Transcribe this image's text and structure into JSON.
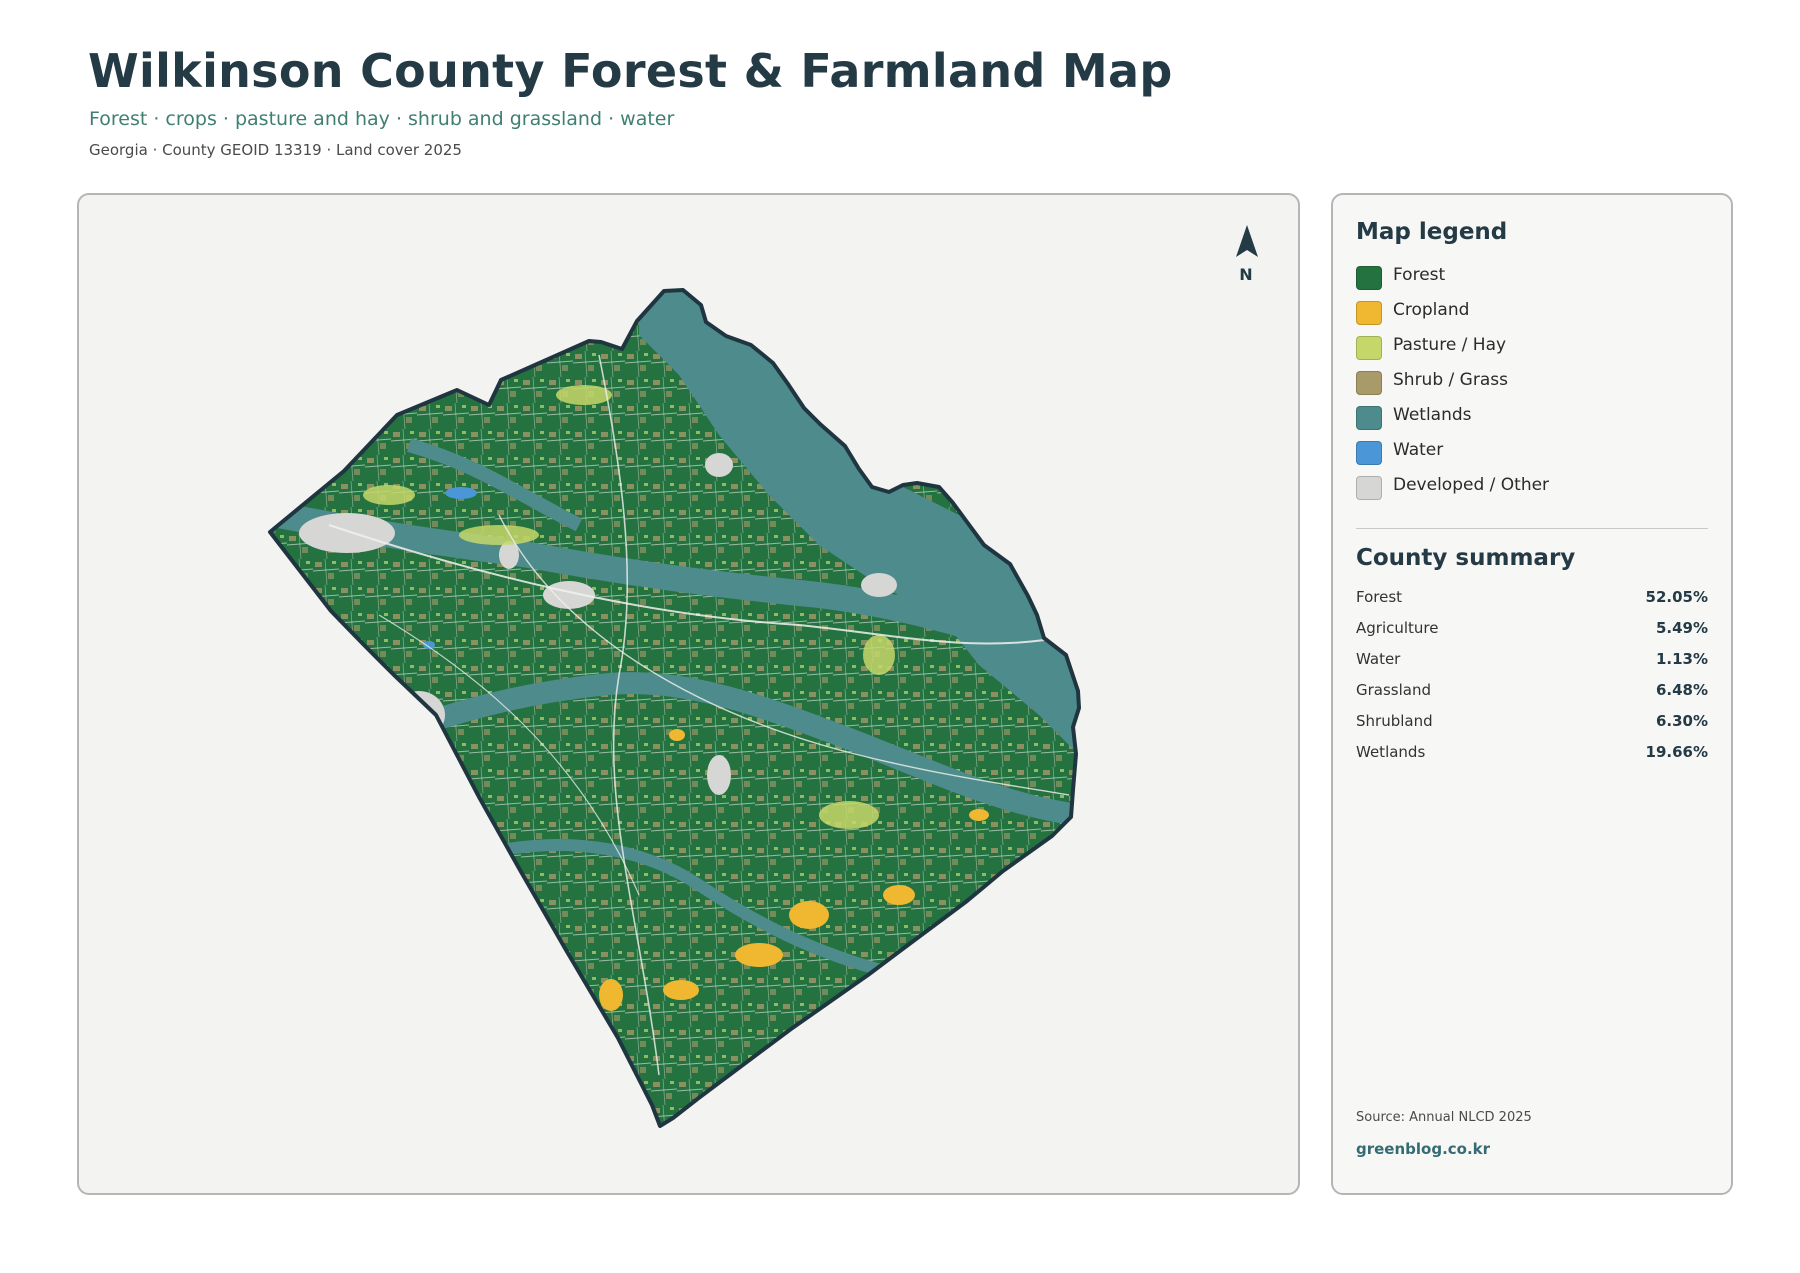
{
  "header": {
    "title": "Wilkinson County Forest & Farmland Map",
    "subtitle": "Forest · crops · pasture and hay · shrub and grassland · water",
    "meta": "Georgia · County GEOID 13319 · Land cover 2025"
  },
  "map": {
    "north_label": "N"
  },
  "legend": {
    "title": "Map legend",
    "items": [
      {
        "label": "Forest",
        "color": "#237240"
      },
      {
        "label": "Cropland",
        "color": "#efb830"
      },
      {
        "label": "Pasture / Hay",
        "color": "#c6d76a"
      },
      {
        "label": "Shrub / Grass",
        "color": "#a99a69"
      },
      {
        "label": "Wetlands",
        "color": "#4d8b8d"
      },
      {
        "label": "Water",
        "color": "#4b96d6"
      },
      {
        "label": "Developed / Other",
        "color": "#d6d6d4"
      }
    ]
  },
  "summary": {
    "title": "County summary",
    "rows": [
      {
        "label": "Forest",
        "value": "52.05%"
      },
      {
        "label": "Agriculture",
        "value": "5.49%"
      },
      {
        "label": "Water",
        "value": "1.13%"
      },
      {
        "label": "Grassland",
        "value": "6.48%"
      },
      {
        "label": "Shrubland",
        "value": "6.30%"
      },
      {
        "label": "Wetlands",
        "value": "19.66%"
      }
    ]
  },
  "footer": {
    "source": "Source: Annual NLCD 2025",
    "credit": "greenblog.co.kr"
  }
}
